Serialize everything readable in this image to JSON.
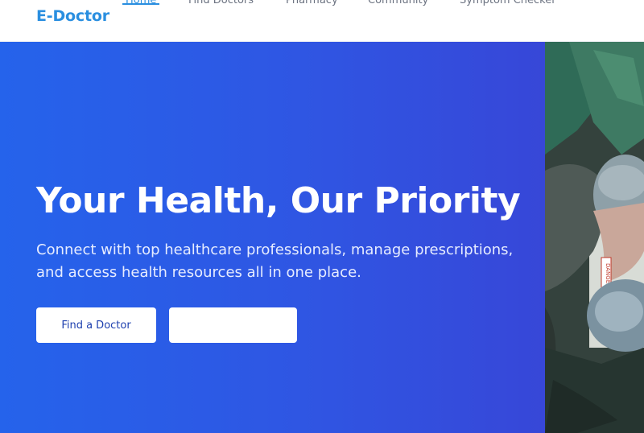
{
  "brand": {
    "name": "E-Doctor"
  },
  "nav": {
    "items": [
      {
        "label": "Home",
        "active": true
      },
      {
        "label": "Find Doctors",
        "active": false
      },
      {
        "label": "Pharmacy",
        "active": false
      },
      {
        "label": "Community",
        "active": false
      },
      {
        "label": "Symptom Checker",
        "active": false
      }
    ]
  },
  "hero": {
    "title": "Your Health, Our Priority",
    "subtitle": "Connect with top healthcare professionals, manage prescriptions, and access health resources all in one place.",
    "primary_button": "Find a Doctor",
    "secondary_button": ""
  },
  "colors": {
    "brand": "#2a8fe0",
    "hero_gradient_start": "#2563eb",
    "hero_gradient_end": "#3747d8",
    "button_text": "#1e40af"
  },
  "photo": {
    "label": "DANGER"
  }
}
